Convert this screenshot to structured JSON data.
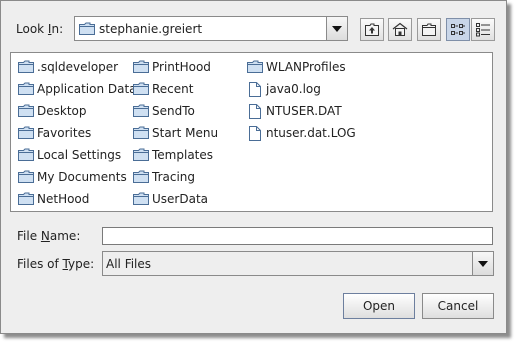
{
  "look_in": {
    "label": "Look In:",
    "label_prefix": "Look ",
    "label_mnemonic": "I",
    "label_suffix": "n:",
    "value": "stephanie.greiert"
  },
  "toolbar": {
    "up_icon": "up-one-level-icon",
    "home_icon": "home-icon",
    "new_folder_icon": "new-folder-icon",
    "list_icon": "list-view-icon",
    "details_icon": "details-view-icon",
    "selected_view": "list"
  },
  "files": {
    "column1": [
      {
        "name": ".sqldeveloper",
        "type": "folder"
      },
      {
        "name": "Application Data",
        "type": "folder"
      },
      {
        "name": "Desktop",
        "type": "folder"
      },
      {
        "name": "Favorites",
        "type": "folder"
      },
      {
        "name": "Local Settings",
        "type": "folder"
      },
      {
        "name": "My Documents",
        "type": "folder"
      },
      {
        "name": "NetHood",
        "type": "folder"
      }
    ],
    "column2": [
      {
        "name": "PrintHood",
        "type": "folder"
      },
      {
        "name": "Recent",
        "type": "folder"
      },
      {
        "name": "SendTo",
        "type": "folder"
      },
      {
        "name": "Start Menu",
        "type": "folder"
      },
      {
        "name": "Templates",
        "type": "folder"
      },
      {
        "name": "Tracing",
        "type": "folder"
      },
      {
        "name": "UserData",
        "type": "folder"
      }
    ],
    "column3": [
      {
        "name": "WLANProfiles",
        "type": "folder"
      },
      {
        "name": "java0.log",
        "type": "file"
      },
      {
        "name": "NTUSER.DAT",
        "type": "file"
      },
      {
        "name": "ntuser.dat.LOG",
        "type": "file"
      }
    ]
  },
  "file_name": {
    "label": "File Name:",
    "label_prefix": "File ",
    "label_mnemonic": "N",
    "label_suffix": "ame:",
    "value": ""
  },
  "file_type": {
    "label": "Files of Type:",
    "label_prefix": "Files of ",
    "label_mnemonic": "T",
    "label_suffix": "ype:",
    "value": "All Files"
  },
  "buttons": {
    "open": "Open",
    "cancel": "Cancel"
  },
  "colors": {
    "dialog_bg": "#eeeeee",
    "folder_fill": "#cfe0f2",
    "folder_stroke": "#4a6d96",
    "selected_toggle": "#c9d6e8"
  }
}
